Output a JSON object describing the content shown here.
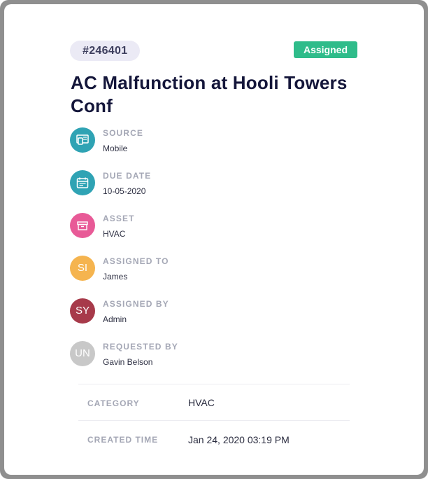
{
  "ticket": {
    "id": "#246401",
    "status": "Assigned",
    "status_color": "#2fbc8a",
    "title": "AC Malfunction at Hooli Towers Conf"
  },
  "fields": [
    {
      "label": "SOURCE",
      "value": "Mobile",
      "icon": "mobile-screen-icon",
      "color": "#2fa3b4"
    },
    {
      "label": "DUE DATE",
      "value": "10-05-2020",
      "icon": "calendar-icon",
      "color": "#2fa3b4"
    },
    {
      "label": "ASSET",
      "value": "HVAC",
      "icon": "asset-box-icon",
      "color": "#e85a97"
    },
    {
      "label": "ASSIGNED TO",
      "value": "James",
      "initials": "SI",
      "color": "#f5b44f"
    },
    {
      "label": "ASSIGNED BY",
      "value": "Admin",
      "initials": "SY",
      "color": "#a73a4a"
    },
    {
      "label": "REQUESTED BY",
      "value": "Gavin Belson",
      "initials": "UN",
      "color": "#c8c8c8"
    }
  ],
  "details": {
    "category_label": "CATEGORY",
    "category_value": "HVAC",
    "created_label": "CREATED TIME",
    "created_value": "Jan 24, 2020 03:19 PM"
  }
}
